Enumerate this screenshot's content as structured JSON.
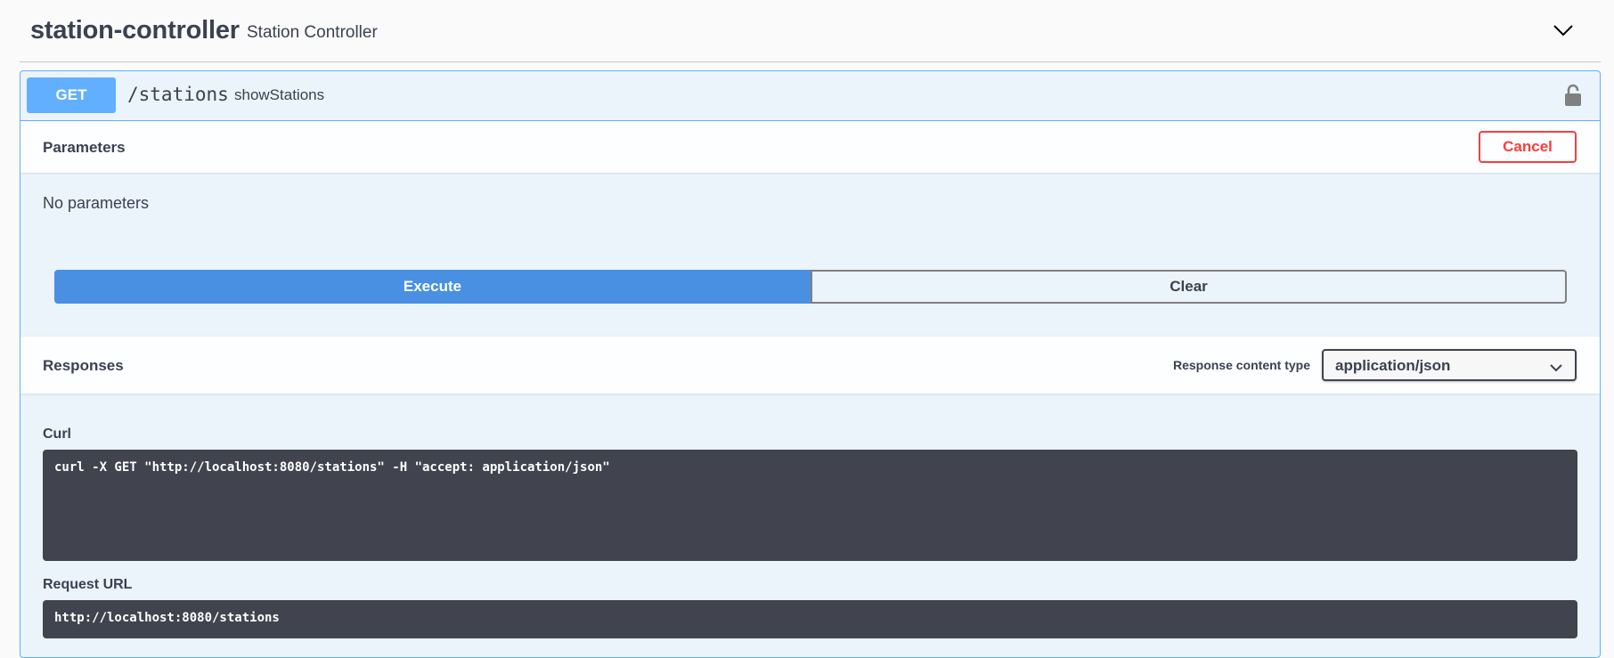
{
  "tag": {
    "name": "station-controller",
    "description": "Station Controller",
    "toggle_icon": "chevron-down-icon"
  },
  "operation": {
    "method": "GET",
    "path": "/stations",
    "operation_id": "showStations",
    "lock_icon": "lock-icon"
  },
  "parameters": {
    "title": "Parameters",
    "cancel_label": "Cancel",
    "empty_text": "No parameters"
  },
  "actions": {
    "execute_label": "Execute",
    "clear_label": "Clear"
  },
  "responses": {
    "title": "Responses",
    "content_type_label": "Response content type",
    "content_type_value": "application/json"
  },
  "curl": {
    "label": "Curl",
    "command": "curl -X GET \"http://localhost:8080/stations\" -H \"accept: application/json\""
  },
  "request_url": {
    "label": "Request URL",
    "value": "http://localhost:8080/stations"
  },
  "colors": {
    "get_method": "#61affe",
    "execute": "#4990e2",
    "cancel": "#f93e3e",
    "code_bg": "#41444e",
    "opblock_bg": "#ebf3fb"
  }
}
